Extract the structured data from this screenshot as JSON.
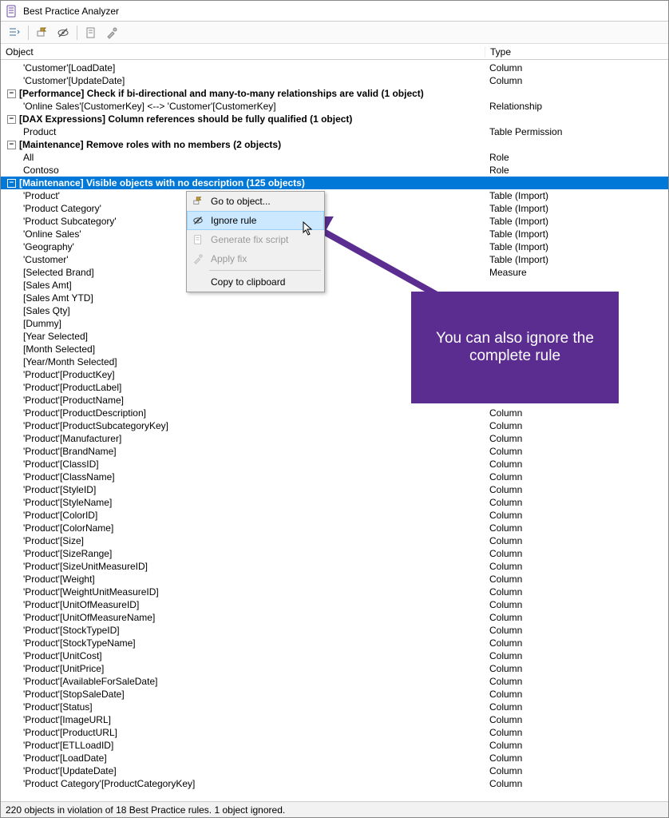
{
  "window": {
    "title": "Best Practice Analyzer"
  },
  "columns": {
    "object": "Object",
    "type": "Type"
  },
  "toolbar_icons": [
    "expand-collapse",
    "goto",
    "ignore",
    "script",
    "fix"
  ],
  "rows": [
    {
      "kind": "child",
      "obj": "'Customer'[LoadDate]",
      "type": "Column"
    },
    {
      "kind": "child",
      "obj": "'Customer'[UpdateDate]",
      "type": "Column"
    },
    {
      "kind": "group",
      "expanded": true,
      "obj": "[Performance] Check if bi-directional and many-to-many relationships are valid (1 object)",
      "type": ""
    },
    {
      "kind": "child",
      "obj": "'Online Sales'[CustomerKey] <--> 'Customer'[CustomerKey]",
      "type": "Relationship"
    },
    {
      "kind": "group",
      "expanded": true,
      "obj": "[DAX Expressions] Column references should be fully qualified (1 object)",
      "type": ""
    },
    {
      "kind": "child",
      "obj": "Product",
      "type": "Table Permission"
    },
    {
      "kind": "group",
      "expanded": true,
      "obj": "[Maintenance] Remove roles with no members (2 objects)",
      "type": ""
    },
    {
      "kind": "child",
      "obj": "All",
      "type": "Role"
    },
    {
      "kind": "child",
      "obj": "Contoso",
      "type": "Role"
    },
    {
      "kind": "group",
      "expanded": true,
      "selected": true,
      "obj": "[Maintenance] Visible objects with no description (125 objects)",
      "type": ""
    },
    {
      "kind": "child",
      "obj": "'Product'",
      "type": "Table (Import)"
    },
    {
      "kind": "child",
      "obj": "'Product Category'",
      "type": "Table (Import)"
    },
    {
      "kind": "child",
      "obj": "'Product Subcategory'",
      "type": "Table (Import)"
    },
    {
      "kind": "child",
      "obj": "'Online Sales'",
      "type": "Table (Import)"
    },
    {
      "kind": "child",
      "obj": "'Geography'",
      "type": "Table (Import)"
    },
    {
      "kind": "child",
      "obj": "'Customer'",
      "type": "Table (Import)"
    },
    {
      "kind": "child",
      "obj": "[Selected Brand]",
      "type": "Measure"
    },
    {
      "kind": "child",
      "obj": "[Sales Amt]",
      "type": ""
    },
    {
      "kind": "child",
      "obj": "[Sales Amt YTD]",
      "type": ""
    },
    {
      "kind": "child",
      "obj": "[Sales Qty]",
      "type": ""
    },
    {
      "kind": "child",
      "obj": "[Dummy]",
      "type": ""
    },
    {
      "kind": "child",
      "obj": "[Year Selected]",
      "type": ""
    },
    {
      "kind": "child",
      "obj": "[Month Selected]",
      "type": ""
    },
    {
      "kind": "child",
      "obj": "[Year/Month Selected]",
      "type": ""
    },
    {
      "kind": "child",
      "obj": "'Product'[ProductKey]",
      "type": ""
    },
    {
      "kind": "child",
      "obj": "'Product'[ProductLabel]",
      "type": ""
    },
    {
      "kind": "child",
      "obj": "'Product'[ProductName]",
      "type": "Column"
    },
    {
      "kind": "child",
      "obj": "'Product'[ProductDescription]",
      "type": "Column"
    },
    {
      "kind": "child",
      "obj": "'Product'[ProductSubcategoryKey]",
      "type": "Column"
    },
    {
      "kind": "child",
      "obj": "'Product'[Manufacturer]",
      "type": "Column"
    },
    {
      "kind": "child",
      "obj": "'Product'[BrandName]",
      "type": "Column"
    },
    {
      "kind": "child",
      "obj": "'Product'[ClassID]",
      "type": "Column"
    },
    {
      "kind": "child",
      "obj": "'Product'[ClassName]",
      "type": "Column"
    },
    {
      "kind": "child",
      "obj": "'Product'[StyleID]",
      "type": "Column"
    },
    {
      "kind": "child",
      "obj": "'Product'[StyleName]",
      "type": "Column"
    },
    {
      "kind": "child",
      "obj": "'Product'[ColorID]",
      "type": "Column"
    },
    {
      "kind": "child",
      "obj": "'Product'[ColorName]",
      "type": "Column"
    },
    {
      "kind": "child",
      "obj": "'Product'[Size]",
      "type": "Column"
    },
    {
      "kind": "child",
      "obj": "'Product'[SizeRange]",
      "type": "Column"
    },
    {
      "kind": "child",
      "obj": "'Product'[SizeUnitMeasureID]",
      "type": "Column"
    },
    {
      "kind": "child",
      "obj": "'Product'[Weight]",
      "type": "Column"
    },
    {
      "kind": "child",
      "obj": "'Product'[WeightUnitMeasureID]",
      "type": "Column"
    },
    {
      "kind": "child",
      "obj": "'Product'[UnitOfMeasureID]",
      "type": "Column"
    },
    {
      "kind": "child",
      "obj": "'Product'[UnitOfMeasureName]",
      "type": "Column"
    },
    {
      "kind": "child",
      "obj": "'Product'[StockTypeID]",
      "type": "Column"
    },
    {
      "kind": "child",
      "obj": "'Product'[StockTypeName]",
      "type": "Column"
    },
    {
      "kind": "child",
      "obj": "'Product'[UnitCost]",
      "type": "Column"
    },
    {
      "kind": "child",
      "obj": "'Product'[UnitPrice]",
      "type": "Column"
    },
    {
      "kind": "child",
      "obj": "'Product'[AvailableForSaleDate]",
      "type": "Column"
    },
    {
      "kind": "child",
      "obj": "'Product'[StopSaleDate]",
      "type": "Column"
    },
    {
      "kind": "child",
      "obj": "'Product'[Status]",
      "type": "Column"
    },
    {
      "kind": "child",
      "obj": "'Product'[ImageURL]",
      "type": "Column"
    },
    {
      "kind": "child",
      "obj": "'Product'[ProductURL]",
      "type": "Column"
    },
    {
      "kind": "child",
      "obj": "'Product'[ETLLoadID]",
      "type": "Column"
    },
    {
      "kind": "child",
      "obj": "'Product'[LoadDate]",
      "type": "Column"
    },
    {
      "kind": "child",
      "obj": "'Product'[UpdateDate]",
      "type": "Column"
    },
    {
      "kind": "child",
      "obj": "'Product Category'[ProductCategoryKey]",
      "type": "Column"
    }
  ],
  "context_menu": {
    "items": [
      {
        "label": "Go to object...",
        "icon": "goto-icon",
        "enabled": true
      },
      {
        "label": "Ignore rule",
        "icon": "ignore-icon",
        "enabled": true,
        "hover": true
      },
      {
        "label": "Generate fix script",
        "icon": "script-icon",
        "enabled": false
      },
      {
        "label": "Apply fix",
        "icon": "fix-icon",
        "enabled": false
      },
      {
        "sep": true
      },
      {
        "label": "Copy to clipboard",
        "icon": "",
        "enabled": true
      }
    ]
  },
  "callout": {
    "text": "You can also ignore the complete rule"
  },
  "status": "220 objects in violation of 18 Best Practice rules. 1 object ignored."
}
